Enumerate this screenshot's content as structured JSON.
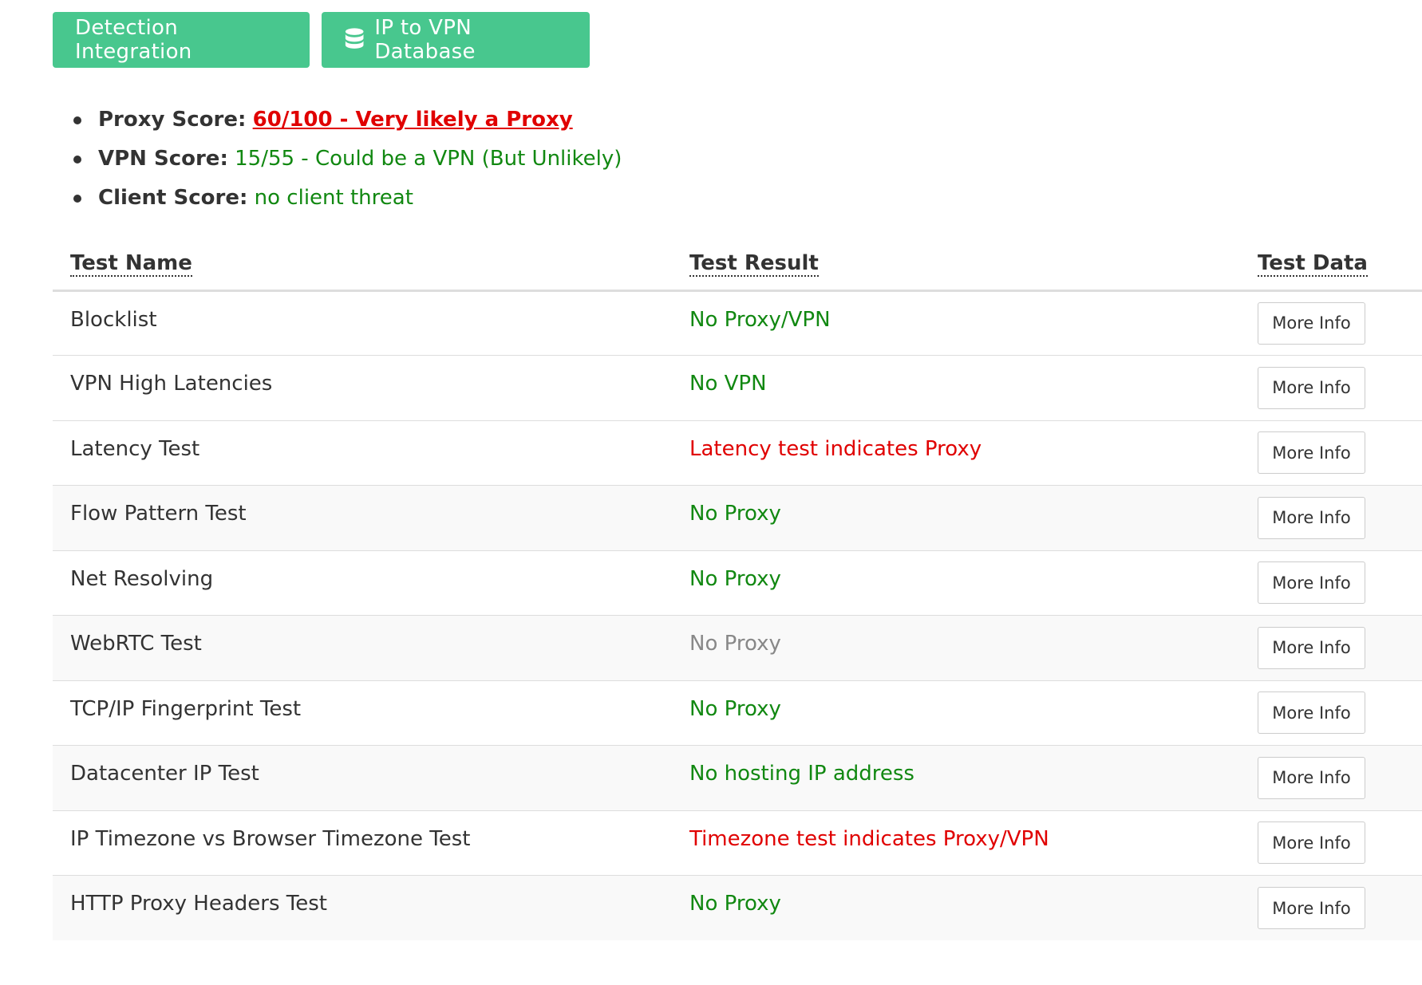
{
  "buttons": {
    "detection_integration": "Detection Integration",
    "ip_to_vpn_database": "IP to VPN Database",
    "db_icon": "database-icon"
  },
  "scores": [
    {
      "label": "Proxy Score:",
      "value": "60/100 - Very likely a Proxy",
      "color": "#e00000"
    },
    {
      "label": "VPN Score:",
      "value": "15/55 - Could be a VPN (But Unlikely)",
      "color": "#118811"
    },
    {
      "label": "Client Score:",
      "value": "no client threat",
      "color": "#118811"
    }
  ],
  "table": {
    "headers": [
      "Test Name",
      "Test Result",
      "Test Data"
    ],
    "rows": [
      {
        "name": "Blocklist",
        "result": "No Proxy/VPN",
        "status": "ok",
        "action": "More Info"
      },
      {
        "name": "VPN High Latencies",
        "result": "No VPN",
        "status": "ok",
        "action": "More Info"
      },
      {
        "name": "Latency Test",
        "result": "Latency test indicates Proxy",
        "status": "bad",
        "action": "More Info"
      },
      {
        "name": "Flow Pattern Test",
        "result": "No Proxy",
        "status": "ok",
        "action": "More Info"
      },
      {
        "name": "Net Resolving",
        "result": "No Proxy",
        "status": "ok",
        "action": "More Info"
      },
      {
        "name": "WebRTC Test",
        "result": "No Proxy",
        "status": "neutral",
        "action": "More Info"
      },
      {
        "name": "TCP/IP Fingerprint Test",
        "result": "No Proxy",
        "status": "ok",
        "action": "More Info"
      },
      {
        "name": "Datacenter IP Test",
        "result": "No hosting IP address",
        "status": "ok",
        "action": "More Info"
      },
      {
        "name": "IP Timezone vs Browser Timezone Test",
        "result": "Timezone test indicates Proxy/VPN",
        "status": "bad",
        "action": "More Info"
      },
      {
        "name": "HTTP Proxy Headers Test",
        "result": "No Proxy",
        "status": "ok",
        "action": "More Info"
      }
    ]
  },
  "colors": {
    "button_green": "#48c78e",
    "ok": "#118811",
    "bad": "#e00000",
    "neutral": "#888888",
    "row_alt": "#f9f9f9"
  }
}
